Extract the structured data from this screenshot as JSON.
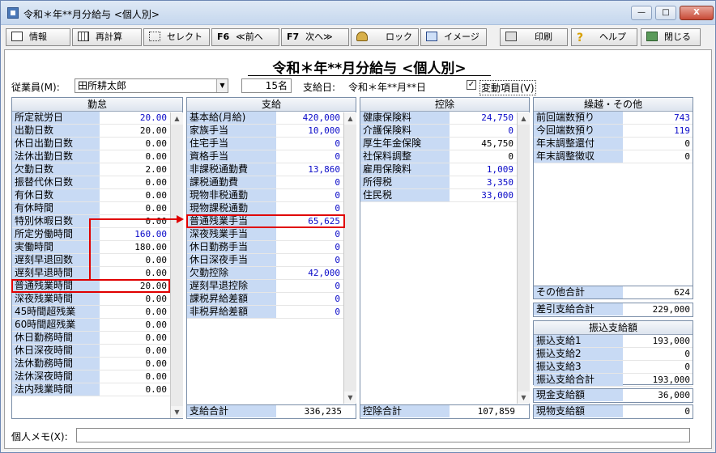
{
  "window": {
    "title": "令和＊年**月分給与 <個人別>",
    "min": "—",
    "max": "□",
    "close": "X"
  },
  "toolbar": {
    "info": "情報",
    "recalc": "再計算",
    "select": "セレクト",
    "prev_key": "F6",
    "prev": "≪前へ",
    "next_key": "F7",
    "next": "次へ≫",
    "lock": "ロック",
    "image": "イメージ",
    "print": "印刷",
    "help": "ヘルプ",
    "close": "閉じる"
  },
  "header": {
    "title": "令和＊年**月分給与 <個人別>",
    "employee_label": "従業員(M):",
    "employee": "田所耕太郎",
    "count": "15名",
    "pay_date_label": "支給日:",
    "pay_date": "令和＊年**月**日",
    "variable_checked": "✓",
    "variable_label": "変動項目(V)"
  },
  "attendance": {
    "title": "勤怠",
    "rows": [
      {
        "label": "所定就労日",
        "value": "20.00",
        "blue": true
      },
      {
        "label": "出勤日数",
        "value": "20.00",
        "blue": false
      },
      {
        "label": "休日出勤日数",
        "value": "0.00",
        "blue": false
      },
      {
        "label": "法休出勤日数",
        "value": "0.00",
        "blue": false
      },
      {
        "label": "欠勤日数",
        "value": "2.00",
        "blue": false
      },
      {
        "label": "振替代休日数",
        "value": "0.00",
        "blue": false
      },
      {
        "label": "有休日数",
        "value": "0.00",
        "blue": false
      },
      {
        "label": "有休時間",
        "value": "0.00",
        "blue": false
      },
      {
        "label": "特別休暇日数",
        "value": "0.00",
        "blue": false
      },
      {
        "label": "所定労働時間",
        "value": "160.00",
        "blue": true
      },
      {
        "label": "実働時間",
        "value": "180.00",
        "blue": false
      },
      {
        "label": "遅刻早退回数",
        "value": "0.00",
        "blue": false
      },
      {
        "label": "遅刻早退時間",
        "value": "0.00",
        "blue": false
      },
      {
        "label": "普通残業時間",
        "value": "20.00",
        "blue": false
      },
      {
        "label": "深夜残業時間",
        "value": "0.00",
        "blue": false
      },
      {
        "label": "45時間超残業",
        "value": "0.00",
        "blue": false
      },
      {
        "label": "60時間超残業",
        "value": "0.00",
        "blue": false
      },
      {
        "label": "休日勤務時間",
        "value": "0.00",
        "blue": false
      },
      {
        "label": "休日深夜時間",
        "value": "0.00",
        "blue": false
      },
      {
        "label": "法休勤務時間",
        "value": "0.00",
        "blue": false
      },
      {
        "label": "法休深夜時間",
        "value": "0.00",
        "blue": false
      },
      {
        "label": "法内残業時間",
        "value": "0.00",
        "blue": false
      }
    ]
  },
  "payment": {
    "title": "支給",
    "rows": [
      {
        "label": "基本給(月給)",
        "value": "420,000",
        "blue": true
      },
      {
        "label": "家族手当",
        "value": "10,000",
        "blue": true
      },
      {
        "label": "住宅手当",
        "value": "0",
        "blue": true
      },
      {
        "label": "資格手当",
        "value": "0",
        "blue": true
      },
      {
        "label": "非課税通勤費",
        "value": "13,860",
        "blue": true
      },
      {
        "label": "課税通勤費",
        "value": "0",
        "blue": true
      },
      {
        "label": "現物非税通勤",
        "value": "0",
        "blue": true
      },
      {
        "label": "現物課税通勤",
        "value": "0",
        "blue": true
      },
      {
        "label": "普通残業手当",
        "value": "65,625",
        "blue": true
      },
      {
        "label": "深夜残業手当",
        "value": "0",
        "blue": true
      },
      {
        "label": "休日勤務手当",
        "value": "0",
        "blue": true
      },
      {
        "label": "休日深夜手当",
        "value": "0",
        "blue": true
      },
      {
        "label": "欠勤控除",
        "value": "42,000",
        "blue": true
      },
      {
        "label": "遅刻早退控除",
        "value": "0",
        "blue": true
      },
      {
        "label": "課税昇給差額",
        "value": "0",
        "blue": true
      },
      {
        "label": "非税昇給差額",
        "value": "0",
        "blue": true
      }
    ],
    "total_label": "支給合計",
    "total": "336,235"
  },
  "deduction": {
    "title": "控除",
    "rows": [
      {
        "label": "健康保険料",
        "value": "24,750",
        "blue": true
      },
      {
        "label": "介護保険料",
        "value": "0",
        "blue": true
      },
      {
        "label": "厚生年金保険",
        "value": "45,750",
        "blue": false
      },
      {
        "label": "社保料調整",
        "value": "0",
        "blue": false
      },
      {
        "label": "雇用保険料",
        "value": "1,009",
        "blue": true
      },
      {
        "label": "所得税",
        "value": "3,350",
        "blue": true
      },
      {
        "label": "住民税",
        "value": "33,000",
        "blue": true
      }
    ],
    "total_label": "控除合計",
    "total": "107,859"
  },
  "other": {
    "title": "繰越・その他",
    "rows": [
      {
        "label": "前回端数預り",
        "value": "743",
        "blue": true
      },
      {
        "label": "今回端数預り",
        "value": "119",
        "blue": true
      },
      {
        "label": "年末調整還付",
        "value": "0",
        "blue": false
      },
      {
        "label": "年末調整徴収",
        "value": "0",
        "blue": false
      }
    ],
    "total_label": "その他合計",
    "total": "624"
  },
  "net": {
    "label": "差引支給合計",
    "value": "229,000"
  },
  "transfer": {
    "title": "振込支給額",
    "rows": [
      {
        "label": "振込支給1",
        "value": "193,000"
      },
      {
        "label": "振込支給2",
        "value": "0"
      },
      {
        "label": "振込支給3",
        "value": "0"
      },
      {
        "label": "振込支給合計",
        "value": "193,000"
      }
    ]
  },
  "cash": {
    "label": "現金支給額",
    "value": "36,000"
  },
  "goods": {
    "label": "現物支給額",
    "value": "0"
  },
  "memo": {
    "label": "個人メモ(X):",
    "value": ""
  },
  "scroll": {
    "up": "▲",
    "down": "▼"
  }
}
